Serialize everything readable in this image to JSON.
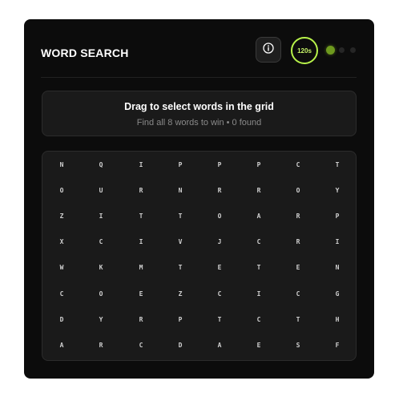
{
  "header": {
    "title": "WORD SEARCH",
    "timer": "120s",
    "info_icon": "info-icon"
  },
  "instructions": {
    "title": "Drag to select words in the grid",
    "subtitle": "Find all 8 words to win • 0 found"
  },
  "colors": {
    "accent": "#b7f24a",
    "background": "#0c0c0c",
    "panel": "#1a1a1a"
  },
  "grid": [
    [
      "N",
      "Q",
      "I",
      "P",
      "P",
      "P",
      "C",
      "T"
    ],
    [
      "O",
      "U",
      "R",
      "N",
      "R",
      "R",
      "O",
      "Y"
    ],
    [
      "Z",
      "I",
      "T",
      "T",
      "O",
      "A",
      "R",
      "P"
    ],
    [
      "X",
      "C",
      "I",
      "V",
      "J",
      "C",
      "R",
      "I"
    ],
    [
      "W",
      "K",
      "M",
      "T",
      "E",
      "T",
      "E",
      "N"
    ],
    [
      "C",
      "O",
      "E",
      "Z",
      "C",
      "I",
      "C",
      "G"
    ],
    [
      "D",
      "Y",
      "R",
      "P",
      "T",
      "C",
      "T",
      "H"
    ],
    [
      "A",
      "R",
      "C",
      "D",
      "A",
      "E",
      "S",
      "F"
    ]
  ]
}
